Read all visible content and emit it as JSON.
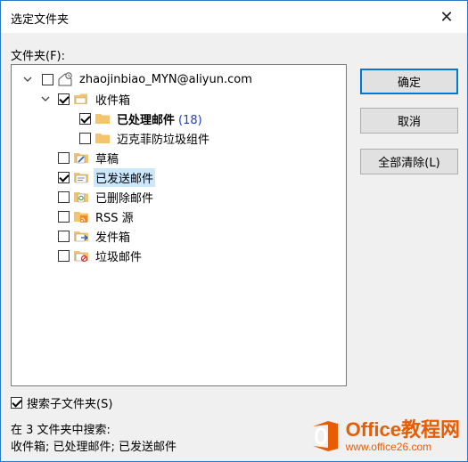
{
  "window": {
    "title": "选定文件夹",
    "close_symbol": "✕"
  },
  "folders_label": "文件夹(F):",
  "tree": {
    "root": {
      "label": "zhaojinbiao_MYN@aliyun.com",
      "checked": false,
      "expanded": true
    },
    "inbox": {
      "label": "收件箱",
      "checked": true,
      "expanded": true
    },
    "processed": {
      "label": "已处理邮件",
      "count": "(18)",
      "checked": true
    },
    "mcafee": {
      "label": "迈克菲防垃圾组件",
      "checked": false
    },
    "drafts": {
      "label": "草稿",
      "checked": false
    },
    "sent": {
      "label": "已发送邮件",
      "checked": true,
      "selected": true
    },
    "deleted": {
      "label": "已删除邮件",
      "checked": false
    },
    "rss": {
      "label": "RSS 源",
      "checked": false
    },
    "outbox": {
      "label": "发件箱",
      "checked": false
    },
    "junk": {
      "label": "垃圾邮件",
      "checked": false
    }
  },
  "buttons": {
    "ok": "确定",
    "cancel": "取消",
    "clear_all": "全部清除(L)"
  },
  "search_subfolders": {
    "label": "搜索子文件夹(S)",
    "checked": true
  },
  "search_in": {
    "title": "在 3 文件夹中搜索:",
    "list": "收件箱; 已处理邮件; 已发送邮件"
  },
  "watermark": {
    "brand": "Office教程网",
    "url": "www.office26.com"
  },
  "colors": {
    "accent": "#0078d7",
    "selection": "#cce8ff",
    "folder": "#f2c46d",
    "count": "#1f3fb5",
    "watermark": "#e85d04"
  }
}
